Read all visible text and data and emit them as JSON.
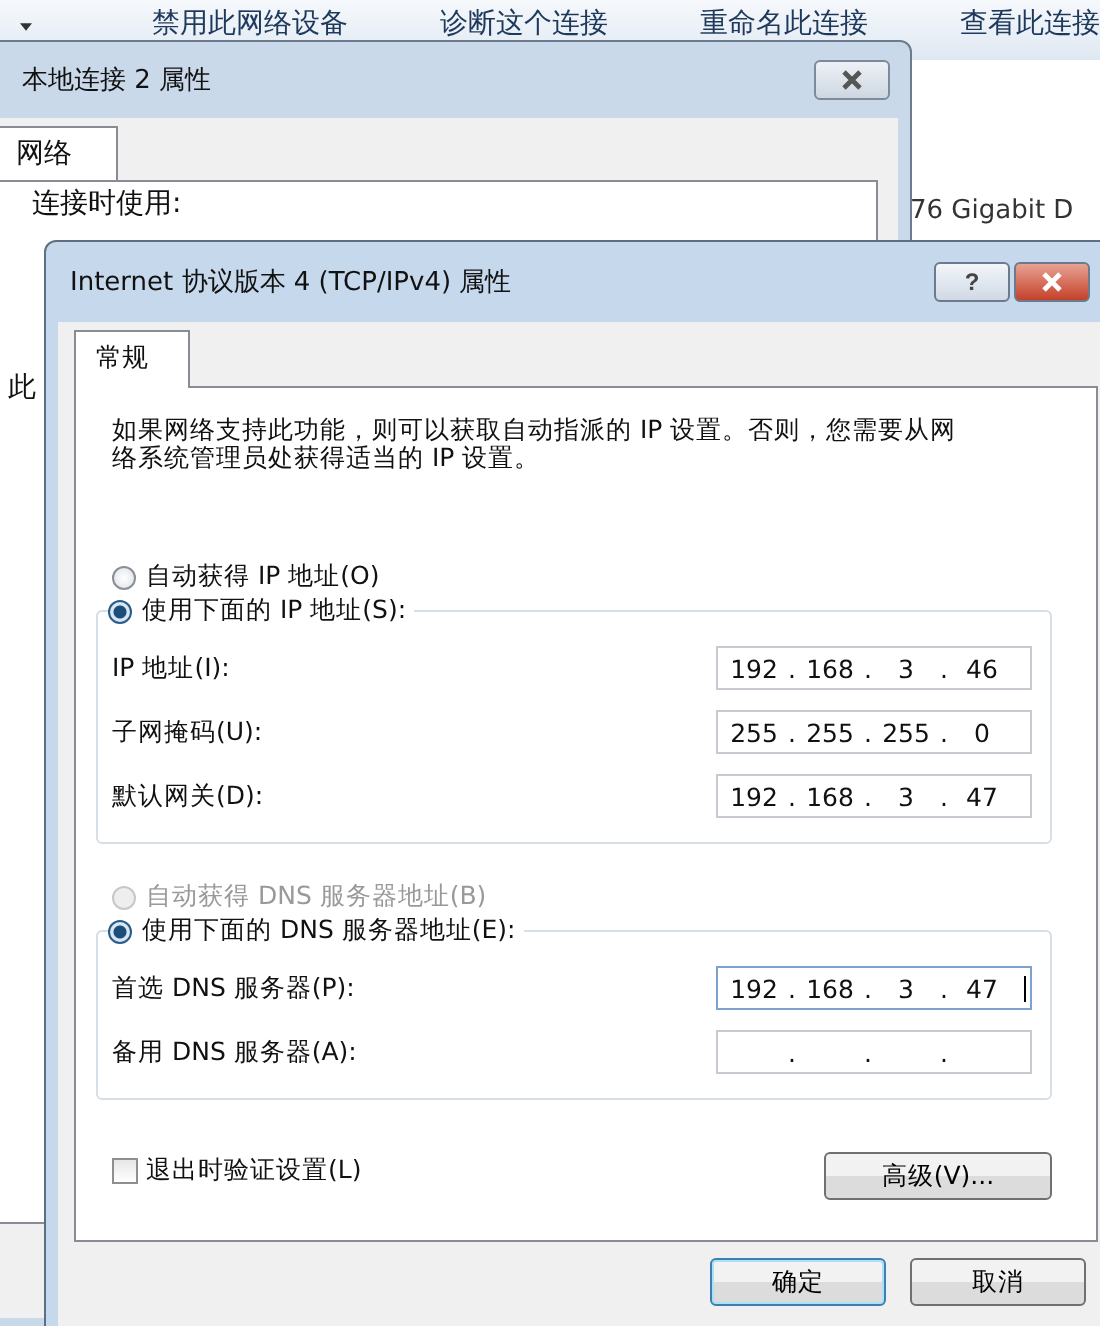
{
  "toolbar": {
    "items": [
      "禁用此网络设备",
      "诊断这个连接",
      "重命名此连接",
      "查看此连接"
    ]
  },
  "background_text": "76 Gigabit D",
  "back_window": {
    "title": "本地连接 2 属性",
    "tab": "网络",
    "label": "连接时使用:",
    "cut_label": "此"
  },
  "dialog": {
    "title": "Internet 协议版本 4 (TCP/IPv4) 属性",
    "help": "?",
    "tabs": [
      {
        "label": "常规",
        "selected": true
      }
    ],
    "description": "如果网络支持此功能，则可以获取自动指派的 IP 设置。否则，您需要从网络系统管理员处获得适当的 IP 设置。",
    "ip_separator": ".",
    "ip_options": [
      {
        "label": "自动获得 IP 地址(O)",
        "selected": false,
        "disabled": false
      },
      {
        "label": "使用下面的 IP 地址(S):",
        "selected": true,
        "disabled": false
      }
    ],
    "ip_fields": [
      {
        "label": "IP 地址(I):",
        "octets": [
          "192",
          "168",
          "3",
          "46"
        ],
        "focused": false
      },
      {
        "label": "子网掩码(U):",
        "octets": [
          "255",
          "255",
          "255",
          "0"
        ],
        "focused": false
      },
      {
        "label": "默认网关(D):",
        "octets": [
          "192",
          "168",
          "3",
          "47"
        ],
        "focused": false
      }
    ],
    "dns_options": [
      {
        "label": "自动获得 DNS 服务器地址(B)",
        "selected": false,
        "disabled": true
      },
      {
        "label": "使用下面的 DNS 服务器地址(E):",
        "selected": true,
        "disabled": false
      }
    ],
    "dns_fields": [
      {
        "label": "首选 DNS 服务器(P):",
        "octets": [
          "192",
          "168",
          "3",
          "47"
        ],
        "focused": true
      },
      {
        "label": "备用 DNS 服务器(A):",
        "focused": false
      }
    ],
    "validate": {
      "label": "退出时验证设置(L)",
      "checked": false
    },
    "advanced": "高级(V)...",
    "buttons": [
      {
        "label": "确定",
        "default": true
      },
      {
        "label": "取消",
        "default": false
      }
    ]
  }
}
